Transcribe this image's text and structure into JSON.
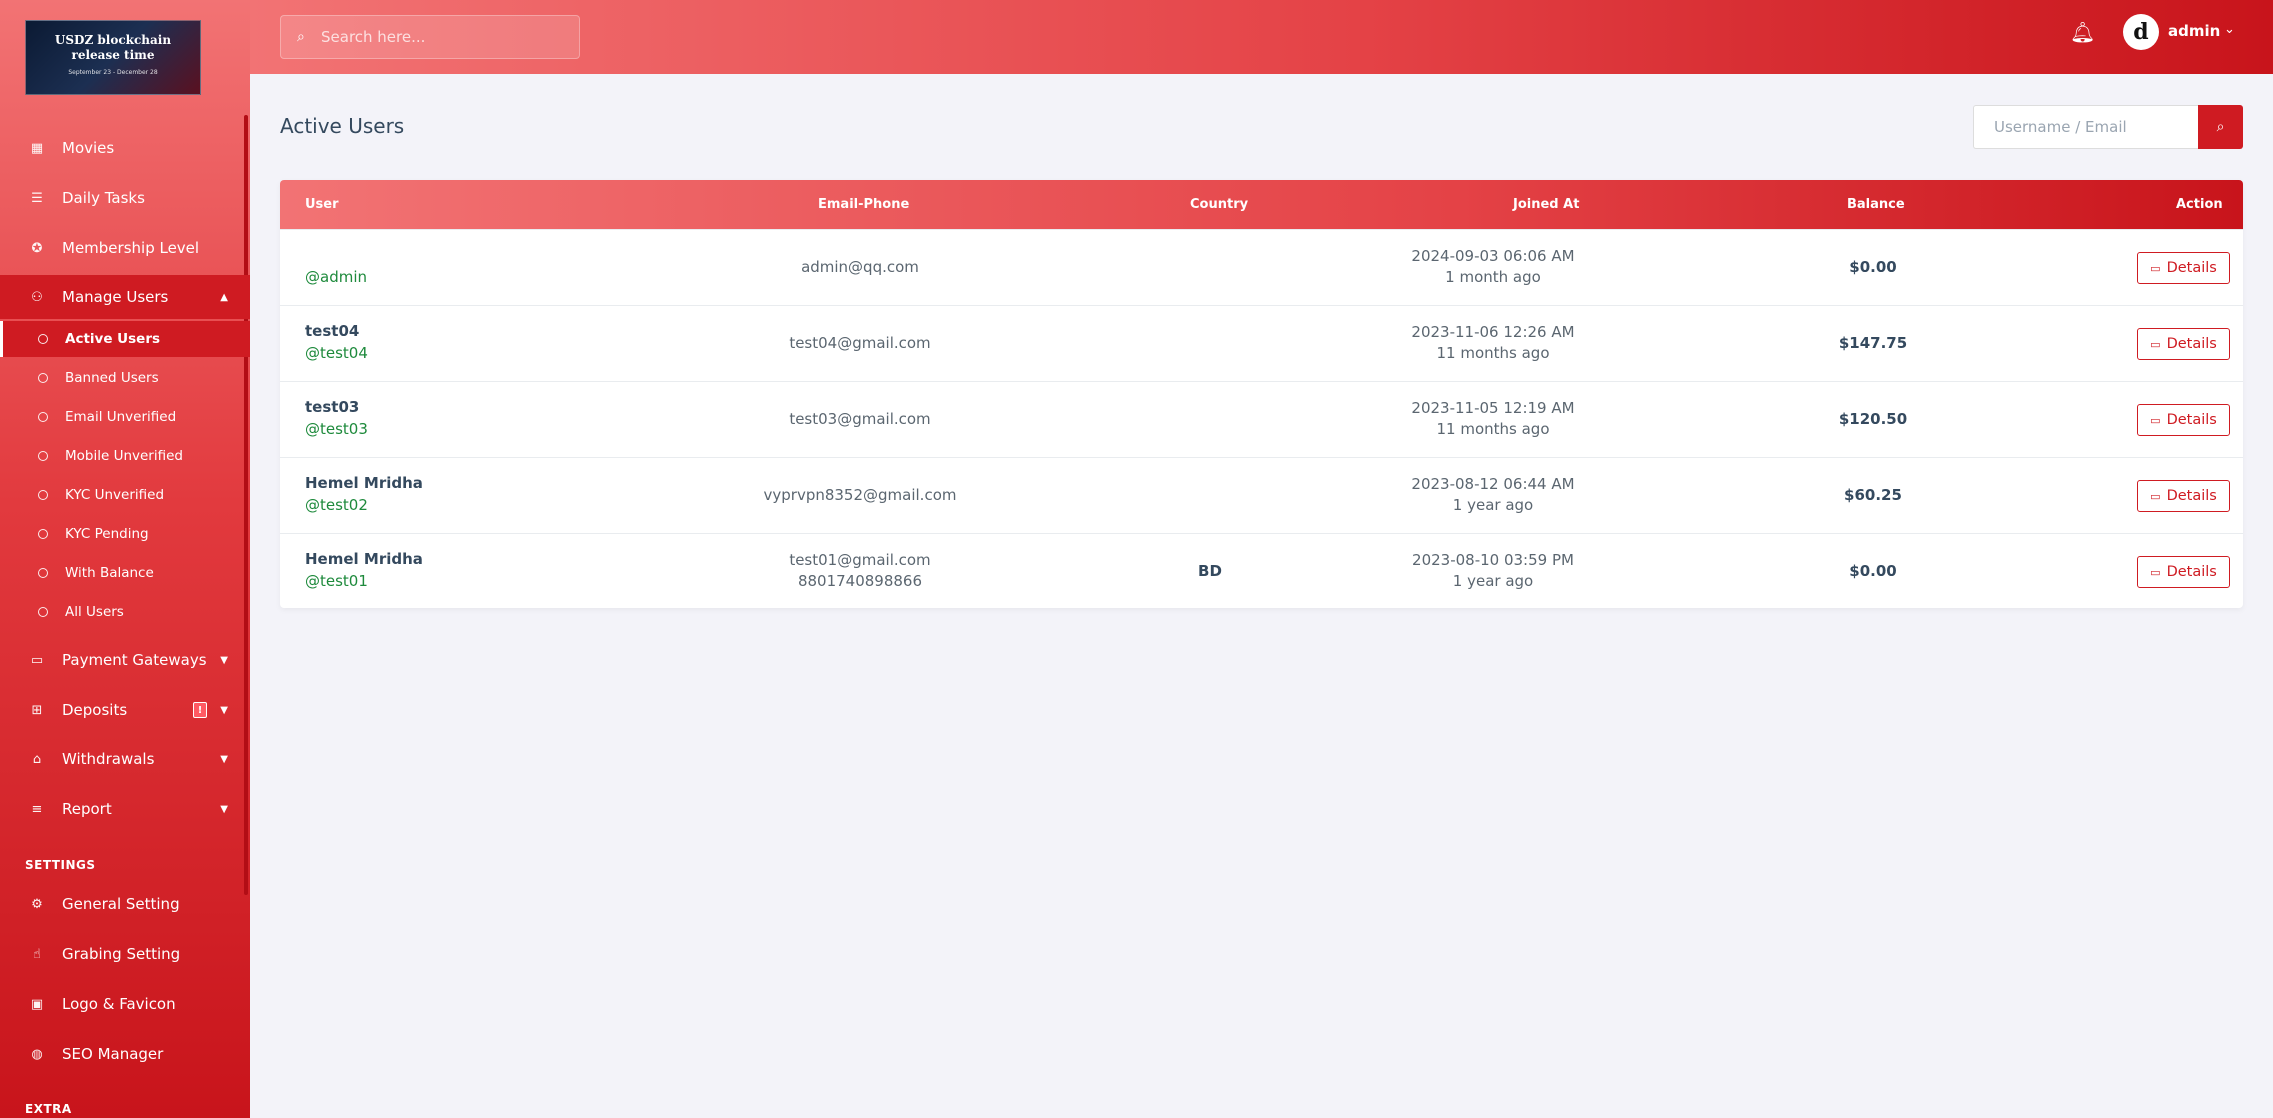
{
  "sidebar": {
    "logo_line1": "USDZ blockchain",
    "logo_line2": "release time",
    "logo_sub": "September 23 - December 28",
    "items": [
      {
        "label": "Movies",
        "icon": "film-icon"
      },
      {
        "label": "Daily Tasks",
        "icon": "list-icon"
      },
      {
        "label": "Membership Level",
        "icon": "award-icon"
      },
      {
        "label": "Manage Users",
        "icon": "users-icon"
      }
    ],
    "manage_users_sub": [
      {
        "label": "Active Users"
      },
      {
        "label": "Banned Users"
      },
      {
        "label": "Email Unverified"
      },
      {
        "label": "Mobile Unverified"
      },
      {
        "label": "KYC Unverified"
      },
      {
        "label": "KYC Pending"
      },
      {
        "label": "With Balance"
      },
      {
        "label": "All Users"
      }
    ],
    "items2": [
      {
        "label": "Payment Gateways",
        "icon": "credit-card-icon"
      },
      {
        "label": "Deposits",
        "icon": "deposit-icon",
        "badge": "!"
      },
      {
        "label": "Withdrawals",
        "icon": "bank-icon"
      },
      {
        "label": "Report",
        "icon": "report-icon"
      }
    ],
    "settings_title": "SETTINGS",
    "settings": [
      {
        "label": "General Setting",
        "icon": "gear-icon"
      },
      {
        "label": "Grabing Setting",
        "icon": "hand-icon"
      },
      {
        "label": "Logo & Favicon",
        "icon": "image-icon"
      },
      {
        "label": "SEO Manager",
        "icon": "globe-icon"
      }
    ],
    "extra_title": "EXTRA"
  },
  "topbar": {
    "search_placeholder": "Search here...",
    "username": "admin",
    "avatar_letter": "d"
  },
  "main": {
    "title": "Active Users",
    "filter_placeholder": "Username / Email"
  },
  "table": {
    "headers": {
      "user": "User",
      "email": "Email-Phone",
      "country": "Country",
      "joined": "Joined At",
      "balance": "Balance",
      "action": "Action"
    },
    "rows": [
      {
        "name": "",
        "handle": "@admin",
        "email": "admin@qq.com",
        "phone": "",
        "country": "",
        "joined": "2024-09-03 06:06 AM",
        "ago": "1 month ago",
        "balance": "$0.00",
        "action": "Details"
      },
      {
        "name": "test04",
        "handle": "@test04",
        "email": "test04@gmail.com",
        "phone": "",
        "country": "",
        "joined": "2023-11-06 12:26 AM",
        "ago": "11 months ago",
        "balance": "$147.75",
        "action": "Details"
      },
      {
        "name": "test03",
        "handle": "@test03",
        "email": "test03@gmail.com",
        "phone": "",
        "country": "",
        "joined": "2023-11-05 12:19 AM",
        "ago": "11 months ago",
        "balance": "$120.50",
        "action": "Details"
      },
      {
        "name": "Hemel Mridha",
        "handle": "@test02",
        "email": "vyprvpn8352@gmail.com",
        "phone": "",
        "country": "",
        "joined": "2023-08-12 06:44 AM",
        "ago": "1 year ago",
        "balance": "$60.25",
        "action": "Details"
      },
      {
        "name": "Hemel Mridha",
        "handle": "@test01",
        "email": "test01@gmail.com",
        "phone": "8801740898866",
        "country": "BD",
        "joined": "2023-08-10 03:59 PM",
        "ago": "1 year ago",
        "balance": "$0.00",
        "action": "Details"
      }
    ]
  },
  "colors": {
    "accent": "#cf1b22",
    "handle_green": "#1e8a3c",
    "bg": "#f3f3f9"
  }
}
